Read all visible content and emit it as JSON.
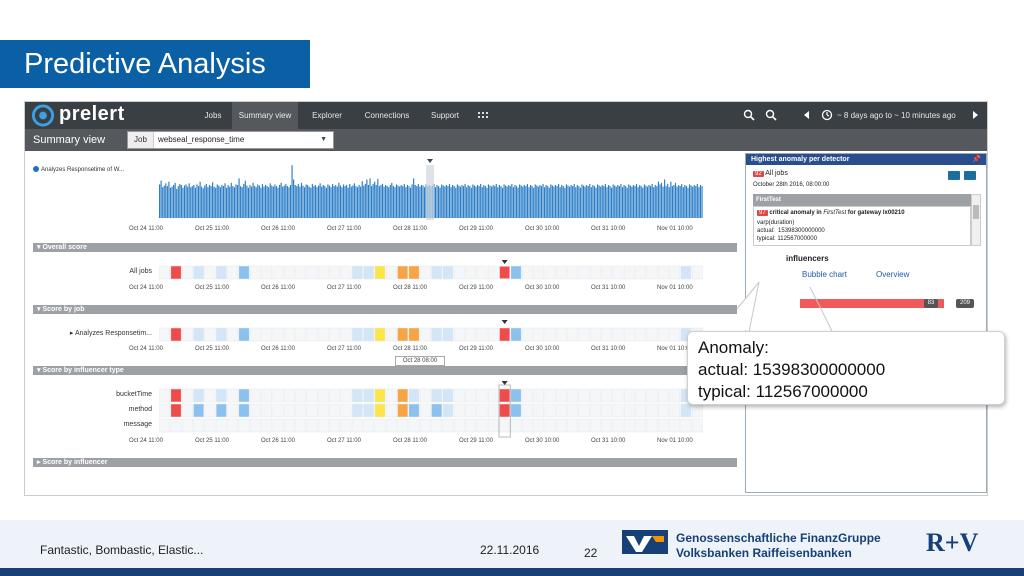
{
  "slide": {
    "title": "Predictive Analysis",
    "footer_left": "Fantastic, Bombastic, Elastic...",
    "footer_date": "22.11.2016",
    "footer_page": "22",
    "org_line1": "Genossenschaftliche FinanzGruppe",
    "org_line2": "Volksbanken Raiffeisenbanken",
    "rv_logo": "R+V"
  },
  "app": {
    "brand": "prelert",
    "nav": [
      "Jobs",
      "Summary view",
      "Explorer",
      "Connections",
      "Support"
    ],
    "active_tab": "Summary view",
    "time_range": "~ 8 days ago to ~ 10 minutes ago",
    "view_title": "Summary view",
    "job_label": "Job",
    "job_value": "webseal_response_time"
  },
  "chart": {
    "legend": "Analyzes Responsetime of W...",
    "x_ticks": [
      "Oct 24 11:00",
      "Oct 25 11:00",
      "Oct 26 11:00",
      "Oct 27 11:00",
      "Oct 28 11:00",
      "Oct 29 11:00",
      "Oct 30 10:00",
      "Oct 31 10:00",
      "Nov 01 10:00"
    ],
    "hover_time": "Oct 28 08:00",
    "bucket_fraction": 0.5,
    "bars": [
      0.61,
      0.68,
      0.56,
      0.59,
      0.63,
      0.58,
      0.66,
      0.55,
      0.57,
      0.6,
      0.64,
      0.53,
      0.58,
      0.62,
      0.6,
      0.55,
      0.59,
      0.61,
      0.57,
      0.63,
      0.56,
      0.58,
      0.6,
      0.55,
      0.61,
      0.58,
      0.66,
      0.57,
      0.54,
      0.59,
      0.62,
      0.56,
      0.6,
      0.58,
      0.65,
      0.57,
      0.55,
      0.61,
      0.59,
      0.56,
      0.6,
      0.58,
      0.63,
      0.55,
      0.6,
      0.57,
      0.64,
      0.58,
      0.56,
      0.61,
      0.6,
      0.72,
      0.58,
      0.56,
      0.62,
      0.68,
      0.59,
      0.55,
      0.6,
      0.57,
      0.64,
      0.58,
      0.56,
      0.61,
      0.59,
      0.55,
      0.62,
      0.57,
      0.6,
      0.58,
      0.56,
      0.63,
      0.59,
      0.57,
      0.61,
      0.58,
      0.55,
      0.6,
      0.64,
      0.57,
      0.59,
      0.62,
      0.58,
      0.56,
      0.6,
      0.96,
      0.7,
      0.6,
      0.58,
      0.62,
      0.57,
      0.64,
      0.59,
      0.56,
      0.61,
      0.6,
      0.57,
      0.55,
      0.62,
      0.58,
      0.6,
      0.56,
      0.59,
      0.63,
      0.57,
      0.6,
      0.58,
      0.55,
      0.61,
      0.59,
      0.56,
      0.62,
      0.58,
      0.6,
      0.57,
      0.64,
      0.59,
      0.56,
      0.61,
      0.58,
      0.6,
      0.55,
      0.62,
      0.57,
      0.59,
      0.63,
      0.58,
      0.56,
      0.6,
      0.57,
      0.67,
      0.59,
      0.62,
      0.7,
      0.6,
      0.72,
      0.58,
      0.62,
      0.66,
      0.6,
      0.71,
      0.58,
      0.6,
      0.62,
      0.57,
      0.6,
      0.58,
      0.56,
      0.6,
      0.64,
      0.58,
      0.56,
      0.61,
      0.59,
      0.57,
      0.6,
      0.58,
      0.62,
      0.56,
      0.6,
      0.58,
      0.55,
      0.61,
      0.72,
      0.6,
      0.58,
      0.62,
      0.57,
      0.6,
      0.59,
      0.56,
      0.61,
      0.58,
      0.6,
      0.57,
      0.59,
      0.62,
      0.56,
      0.6,
      0.58,
      0.55,
      0.61,
      0.59,
      0.57,
      0.6,
      0.58,
      0.62,
      0.56,
      0.6,
      0.58,
      0.55,
      0.61,
      0.59,
      0.57,
      0.6,
      0.58,
      0.62,
      0.56,
      0.6,
      0.58,
      0.55,
      0.61,
      0.59,
      0.57,
      0.6,
      0.58,
      0.62,
      0.56,
      0.6,
      0.58,
      0.55,
      0.61,
      0.59,
      0.57,
      0.6,
      0.58,
      0.62,
      0.56,
      0.6,
      0.58,
      0.55,
      0.61,
      0.59,
      0.57,
      0.6,
      0.58,
      0.62,
      0.56,
      0.6,
      0.58,
      0.55,
      0.61,
      0.59,
      0.57,
      0.6,
      0.58,
      0.62,
      0.56,
      0.6,
      0.58,
      0.55,
      0.61,
      0.59,
      0.57,
      0.6,
      0.58,
      0.62,
      0.56,
      0.6,
      0.58,
      0.55,
      0.61,
      0.59,
      0.57,
      0.6,
      0.58,
      0.62,
      0.56,
      0.6,
      0.58,
      0.55,
      0.61,
      0.59,
      0.57,
      0.6,
      0.58,
      0.62,
      0.56,
      0.6,
      0.58,
      0.55,
      0.61,
      0.59,
      0.57,
      0.6,
      0.58,
      0.62,
      0.56,
      0.6,
      0.58,
      0.55,
      0.61,
      0.59,
      0.57,
      0.6,
      0.58,
      0.62,
      0.56,
      0.6,
      0.58,
      0.55,
      0.61,
      0.59,
      0.57,
      0.6,
      0.58,
      0.62,
      0.56,
      0.6,
      0.58,
      0.55,
      0.61,
      0.59,
      0.57,
      0.6,
      0.58,
      0.62,
      0.56,
      0.6,
      0.58,
      0.55,
      0.61,
      0.59,
      0.57,
      0.6,
      0.58,
      0.62,
      0.56,
      0.6,
      0.58,
      0.66,
      0.61,
      0.64,
      0.57,
      0.7,
      0.58,
      0.62,
      0.56,
      0.66,
      0.58,
      0.6,
      0.64,
      0.57,
      0.6,
      0.58,
      0.62,
      0.56,
      0.6,
      0.58,
      0.55,
      0.61,
      0.59,
      0.57,
      0.6,
      0.58,
      0.62,
      0.56,
      0.6,
      0.58
    ]
  },
  "sections": {
    "overall": "Overall score",
    "by_job": "Score by job",
    "by_influencer_type": "Score by influencer type",
    "by_influencer": "Score by influencer"
  },
  "rows": {
    "all_jobs": "All jobs",
    "job": "Analyzes Responsetim...",
    "bucket_time": "bucketTime",
    "method": "method",
    "message": "message"
  },
  "heatmap": {
    "cells": 48,
    "colors": {
      "red": "#f04b4b",
      "orange": "#f7a445",
      "yellow": "#fbe64a",
      "blue": "#8cc1ee",
      "light": "#d3e6f7",
      "empty": "#f4f6f8"
    },
    "all_jobs": [
      "empty",
      "red",
      "empty",
      "light",
      "empty",
      "light",
      "empty",
      "blue",
      "empty",
      "empty",
      "empty",
      "empty",
      "empty",
      "empty",
      "empty",
      "empty",
      "empty",
      "light",
      "light",
      "yellow",
      "empty",
      "orange",
      "orange",
      "empty",
      "light",
      "light",
      "empty",
      "empty",
      "empty",
      "empty",
      "red",
      "blue",
      "empty",
      "empty",
      "empty",
      "empty",
      "empty",
      "empty",
      "empty",
      "empty",
      "empty",
      "empty",
      "empty",
      "empty",
      "empty",
      "empty",
      "light",
      "empty"
    ],
    "job_row": [
      "empty",
      "red",
      "empty",
      "light",
      "empty",
      "light",
      "empty",
      "blue",
      "empty",
      "empty",
      "empty",
      "empty",
      "empty",
      "empty",
      "empty",
      "empty",
      "empty",
      "light",
      "light",
      "yellow",
      "empty",
      "orange",
      "orange",
      "empty",
      "light",
      "light",
      "empty",
      "empty",
      "empty",
      "empty",
      "red",
      "blue",
      "empty",
      "empty",
      "empty",
      "empty",
      "empty",
      "empty",
      "empty",
      "empty",
      "empty",
      "empty",
      "empty",
      "empty",
      "empty",
      "empty",
      "light",
      "empty"
    ],
    "bucket_row": [
      "empty",
      "red",
      "empty",
      "light",
      "empty",
      "light",
      "empty",
      "blue",
      "empty",
      "empty",
      "empty",
      "empty",
      "empty",
      "empty",
      "empty",
      "empty",
      "empty",
      "light",
      "light",
      "yellow",
      "empty",
      "orange",
      "light",
      "empty",
      "light",
      "light",
      "empty",
      "empty",
      "empty",
      "empty",
      "red",
      "blue",
      "empty",
      "empty",
      "empty",
      "empty",
      "empty",
      "empty",
      "empty",
      "empty",
      "empty",
      "empty",
      "empty",
      "empty",
      "empty",
      "empty",
      "light",
      "empty"
    ],
    "method_row": [
      "empty",
      "red",
      "empty",
      "blue",
      "empty",
      "blue",
      "empty",
      "blue",
      "empty",
      "empty",
      "empty",
      "empty",
      "empty",
      "empty",
      "empty",
      "empty",
      "empty",
      "light",
      "light",
      "yellow",
      "empty",
      "orange",
      "blue",
      "empty",
      "blue",
      "light",
      "empty",
      "empty",
      "empty",
      "empty",
      "red",
      "blue",
      "empty",
      "empty",
      "empty",
      "empty",
      "empty",
      "empty",
      "empty",
      "empty",
      "empty",
      "empty",
      "empty",
      "empty",
      "empty",
      "empty",
      "light",
      "empty"
    ],
    "message_row": [
      "empty",
      "empty",
      "empty",
      "empty",
      "empty",
      "empty",
      "empty",
      "empty",
      "empty",
      "empty",
      "empty",
      "empty",
      "empty",
      "empty",
      "empty",
      "empty",
      "empty",
      "empty",
      "empty",
      "empty",
      "empty",
      "empty",
      "empty",
      "empty",
      "empty",
      "empty",
      "empty",
      "empty",
      "empty",
      "empty",
      "empty",
      "empty",
      "empty",
      "empty",
      "empty",
      "empty",
      "empty",
      "empty",
      "empty",
      "empty",
      "empty",
      "empty",
      "empty",
      "empty",
      "empty",
      "empty",
      "empty",
      "empty"
    ],
    "marker_index": 30
  },
  "panel": {
    "title": "Highest anomaly per detector",
    "score_badge": "92",
    "jobs": "All jobs",
    "date": "October 28th 2016, 08:00:00",
    "detector": "FirstTest",
    "anomaly_badge": "97",
    "anomaly_prefix": "critical anomaly in",
    "anomaly_detector": "FirstTest",
    "anomaly_suffix": "for gateway lx00210",
    "function": "varp(duration)",
    "actual_label": "actual:",
    "actual_value": "15398300000000",
    "typical_label": "typical:",
    "typical_value": "112567000000",
    "influencers_title": "influencers",
    "tab_bubble": "Bubble chart",
    "tab_overview": "Overview",
    "bar_value": "83",
    "bar_total": "209"
  },
  "callout": {
    "line1": "Anomaly:",
    "line2": "actual: 15398300000000",
    "line3": "typical: 112567000000"
  }
}
